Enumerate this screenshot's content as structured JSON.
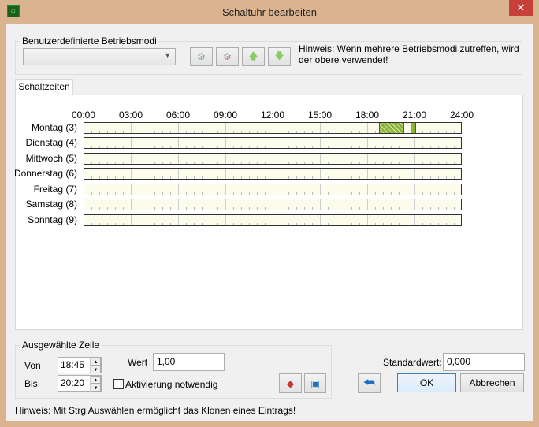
{
  "window": {
    "title": "Schaltuhr bearbeiten",
    "close": "✕"
  },
  "modes": {
    "group_label": "Benutzerdefinierte Betriebsmodi",
    "selected": "",
    "hint": "Hinweis: Wenn mehrere Betriebsmodi zutreffen, wird der obere verwendet!"
  },
  "tabs": [
    {
      "label": "Schaltzeiten"
    }
  ],
  "timeline": {
    "hours": [
      "00:00",
      "03:00",
      "06:00",
      "09:00",
      "12:00",
      "15:00",
      "18:00",
      "21:00",
      "24:00"
    ],
    "days": [
      "Montag (3)",
      "Dienstag (4)",
      "Mittwoch (5)",
      "Donnerstag (6)",
      "Freitag (7)",
      "Samstag (8)",
      "Sonntag (9)"
    ],
    "segments": [
      {
        "day": 0,
        "start": "18:45",
        "end": "20:20",
        "selected": true
      },
      {
        "day": 0,
        "start": "20:45",
        "end": "21:05",
        "selected": false
      }
    ],
    "colors": {
      "segment": "#8db43a",
      "border": "#a33333"
    }
  },
  "selection": {
    "group_label": "Ausgewählte Zeile",
    "von_label": "Von",
    "von": "18:45",
    "bis_label": "Bis",
    "bis": "20:20",
    "wert_label": "Wert",
    "wert": "1,00",
    "activation_label": "Aktivierung notwendig",
    "activation_checked": false
  },
  "standard": {
    "label": "Standardwert:",
    "value": "0,000"
  },
  "buttons": {
    "ok": "OK",
    "cancel": "Abbrechen"
  },
  "footer_hint": "Hinweis: Mit Strg Auswählen ermöglicht das Klonen eines Eintrags!"
}
